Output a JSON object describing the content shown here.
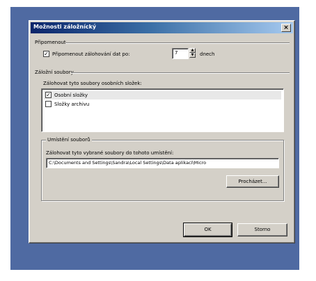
{
  "dialog": {
    "title": "Možnosti záložnícký",
    "close_glyph": "×"
  },
  "reminder": {
    "group_label": "Připomenout",
    "checkbox_checked_glyph": "✓",
    "label": "Připomenout zálohování dat po:",
    "days_value": "7",
    "unit": "dnech"
  },
  "files": {
    "group_label": "Záložní soubory",
    "list_label": "Zálohovat tyto soubory osobních složek:",
    "items": [
      {
        "label": "Osobní složky",
        "checked": true,
        "check_glyph": "✓"
      },
      {
        "label": "Složky archivu",
        "checked": false,
        "check_glyph": ""
      }
    ]
  },
  "location": {
    "group_label": "Umístění souborů",
    "label": "Zálohovat tyto vybrané soubory do tohoto umístění:",
    "path": "C:\\Documents and Settings\\Sandra\\Local Settings\\Data aplikací\\Micro",
    "browse_label": "Procházet..."
  },
  "buttons": {
    "ok_label": "OK",
    "cancel_label": "Storno"
  }
}
